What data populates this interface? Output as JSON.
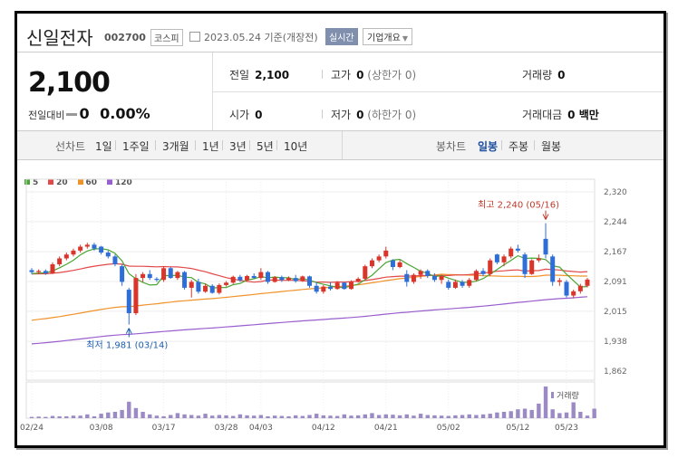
{
  "header": {
    "name": "신일전자",
    "code": "002700",
    "market": "코스피",
    "date": "2023.05.24 기준(개장전)",
    "realtime": "실시간",
    "corp_info": "기업개요"
  },
  "summary": {
    "price": "2,100",
    "change_label": "전일대비",
    "change_value": "0",
    "change_pct": "0.00%",
    "prev_label": "전일",
    "prev_value": "2,100",
    "high_label": "고가",
    "high_value": "0",
    "high_note": "(상한가 0)",
    "volume_label": "거래량",
    "volume_value": "0",
    "open_label": "시가",
    "open_value": "0",
    "low_label": "저가",
    "low_value": "0",
    "low_note": "(하한가 0)",
    "amount_label": "거래대금",
    "amount_value": "0 백만"
  },
  "tabs": {
    "line_label": "선차트",
    "line_items": [
      "1일",
      "1주일",
      "3개월",
      "1년",
      "3년",
      "5년",
      "10년"
    ],
    "candle_label": "봉차트",
    "candle_items": [
      "일봉",
      "주봉",
      "월봉"
    ],
    "candle_active": "일봉"
  },
  "colors": {
    "up": "#d9352b",
    "down": "#2e6ed6",
    "ma5": "#4aa534",
    "ma20": "#e24848",
    "ma60": "#f0922a",
    "ma120": "#9a5fce",
    "volume": "#9b8ac4"
  },
  "chart_data": {
    "type": "candlestick",
    "legend": [
      "5",
      "20",
      "60",
      "120"
    ],
    "x_ticks": [
      "02/24",
      "03/08",
      "03/17",
      "03/28",
      "04/03",
      "04/12",
      "04/21",
      "05/02",
      "05/12",
      "05/23"
    ],
    "x_tick_index": [
      0,
      10,
      19,
      28,
      33,
      42,
      51,
      60,
      70,
      77
    ],
    "y_ticks": [
      "2,320",
      "2,244",
      "2,167",
      "2,091",
      "2,015",
      "1,938",
      "1,862"
    ],
    "ylim": [
      1862,
      2320
    ],
    "volume_label": "거래량",
    "annotations": {
      "high": "최고 2,240 (05/16)",
      "high_value": 2240,
      "high_index": 74,
      "low": "최저 1,981 (03/14)",
      "low_value": 1981,
      "low_index": 14
    },
    "candles": [
      [
        2120,
        2125,
        2110,
        2115
      ],
      [
        2115,
        2122,
        2110,
        2118
      ],
      [
        2118,
        2122,
        2108,
        2112
      ],
      [
        2112,
        2140,
        2110,
        2135
      ],
      [
        2135,
        2155,
        2130,
        2150
      ],
      [
        2150,
        2165,
        2145,
        2160
      ],
      [
        2160,
        2175,
        2155,
        2170
      ],
      [
        2170,
        2185,
        2165,
        2180
      ],
      [
        2180,
        2190,
        2175,
        2185
      ],
      [
        2185,
        2190,
        2170,
        2175
      ],
      [
        2180,
        2182,
        2160,
        2165
      ],
      [
        2165,
        2170,
        2150,
        2155
      ],
      [
        2155,
        2160,
        2130,
        2135
      ],
      [
        2130,
        2135,
        2080,
        2090
      ],
      [
        2070,
        2075,
        1981,
        2010
      ],
      [
        2010,
        2110,
        2005,
        2100
      ],
      [
        2100,
        2115,
        2090,
        2110
      ],
      [
        2110,
        2120,
        2095,
        2100
      ],
      [
        2098,
        2102,
        2090,
        2095
      ],
      [
        2095,
        2130,
        2090,
        2125
      ],
      [
        2125,
        2128,
        2098,
        2100
      ],
      [
        2100,
        2118,
        2095,
        2115
      ],
      [
        2115,
        2118,
        2070,
        2075
      ],
      [
        2075,
        2095,
        2050,
        2090
      ],
      [
        2090,
        2098,
        2060,
        2065
      ],
      [
        2065,
        2085,
        2062,
        2080
      ],
      [
        2080,
        2084,
        2060,
        2062
      ],
      [
        2062,
        2086,
        2058,
        2082
      ],
      [
        2082,
        2092,
        2078,
        2088
      ],
      [
        2088,
        2106,
        2085,
        2103
      ],
      [
        2103,
        2108,
        2090,
        2094
      ],
      [
        2094,
        2108,
        2092,
        2105
      ],
      [
        2105,
        2112,
        2098,
        2100
      ],
      [
        2100,
        2125,
        2095,
        2115
      ],
      [
        2115,
        2118,
        2085,
        2090
      ],
      [
        2090,
        2105,
        2088,
        2102
      ],
      [
        2102,
        2106,
        2090,
        2095
      ],
      [
        2095,
        2104,
        2092,
        2100
      ],
      [
        2100,
        2108,
        2088,
        2092
      ],
      [
        2092,
        2106,
        2090,
        2104
      ],
      [
        2104,
        2106,
        2075,
        2080
      ],
      [
        2080,
        2090,
        2060,
        2065
      ],
      [
        2065,
        2082,
        2060,
        2078
      ],
      [
        2078,
        2090,
        2068,
        2072
      ],
      [
        2072,
        2092,
        2070,
        2088
      ],
      [
        2088,
        2090,
        2070,
        2072
      ],
      [
        2072,
        2094,
        2070,
        2090
      ],
      [
        2090,
        2102,
        2088,
        2098
      ],
      [
        2098,
        2134,
        2095,
        2130
      ],
      [
        2130,
        2150,
        2125,
        2145
      ],
      [
        2145,
        2160,
        2140,
        2155
      ],
      [
        2155,
        2180,
        2150,
        2170
      ],
      [
        2145,
        2148,
        2120,
        2128
      ],
      [
        2128,
        2146,
        2125,
        2140
      ],
      [
        2110,
        2120,
        2078,
        2090
      ],
      [
        2090,
        2112,
        2085,
        2108
      ],
      [
        2108,
        2122,
        2098,
        2118
      ],
      [
        2118,
        2122,
        2100,
        2105
      ],
      [
        2105,
        2112,
        2090,
        2095
      ],
      [
        2095,
        2108,
        2085,
        2105
      ],
      [
        2090,
        2096,
        2070,
        2075
      ],
      [
        2075,
        2096,
        2072,
        2090
      ],
      [
        2090,
        2095,
        2075,
        2080
      ],
      [
        2080,
        2100,
        2075,
        2095
      ],
      [
        2095,
        2122,
        2092,
        2118
      ],
      [
        2118,
        2125,
        2105,
        2110
      ],
      [
        2110,
        2150,
        2105,
        2145
      ],
      [
        2160,
        2162,
        2135,
        2140
      ],
      [
        2140,
        2160,
        2130,
        2155
      ],
      [
        2155,
        2180,
        2150,
        2175
      ],
      [
        2175,
        2185,
        2165,
        2170
      ],
      [
        2160,
        2165,
        2100,
        2110
      ],
      [
        2110,
        2148,
        2108,
        2145
      ],
      [
        2145,
        2160,
        2140,
        2150
      ],
      [
        2200,
        2240,
        2150,
        2160
      ],
      [
        2155,
        2160,
        2080,
        2090
      ],
      [
        2090,
        2100,
        2080,
        2094
      ],
      [
        2090,
        2095,
        2050,
        2055
      ],
      [
        2055,
        2070,
        2048,
        2066
      ],
      [
        2066,
        2085,
        2060,
        2080
      ],
      [
        2080,
        2100,
        2076,
        2096
      ]
    ],
    "volume": [
      4,
      5,
      4,
      7,
      6,
      6,
      8,
      8,
      12,
      6,
      14,
      18,
      20,
      26,
      52,
      32,
      20,
      12,
      8,
      6,
      10,
      16,
      12,
      10,
      8,
      14,
      8,
      10,
      9,
      7,
      12,
      9,
      8,
      10,
      6,
      8,
      7,
      6,
      9,
      7,
      10,
      14,
      9,
      8,
      7,
      12,
      8,
      9,
      12,
      16,
      10,
      12,
      11,
      9,
      12,
      8,
      14,
      10,
      9,
      8,
      7,
      9,
      10,
      12,
      10,
      12,
      14,
      18,
      20,
      22,
      28,
      30,
      26,
      46,
      100,
      28,
      16,
      18,
      50,
      20,
      8,
      30
    ]
  }
}
